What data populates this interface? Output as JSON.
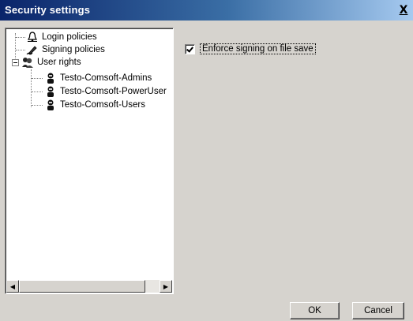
{
  "window": {
    "title": "Security settings",
    "close_label": "X"
  },
  "tree": {
    "items": [
      {
        "label": "Login policies",
        "icon": "bell-icon"
      },
      {
        "label": "Signing policies",
        "icon": "pen-icon"
      },
      {
        "label": "User rights",
        "icon": "user-group-icon"
      },
      {
        "label": "Testo-Comsoft-Admins",
        "icon": "user-icon"
      },
      {
        "label": "Testo-Comsoft-PowerUser",
        "icon": "user-icon"
      },
      {
        "label": "Testo-Comsoft-Users",
        "icon": "user-icon"
      }
    ],
    "scroll_left_icon": "◀",
    "scroll_right_icon": "▶"
  },
  "settings": {
    "enforce_signing_label": "Enforce signing on file save",
    "enforce_signing_checked": true
  },
  "buttons": {
    "ok": "OK",
    "cancel": "Cancel"
  }
}
